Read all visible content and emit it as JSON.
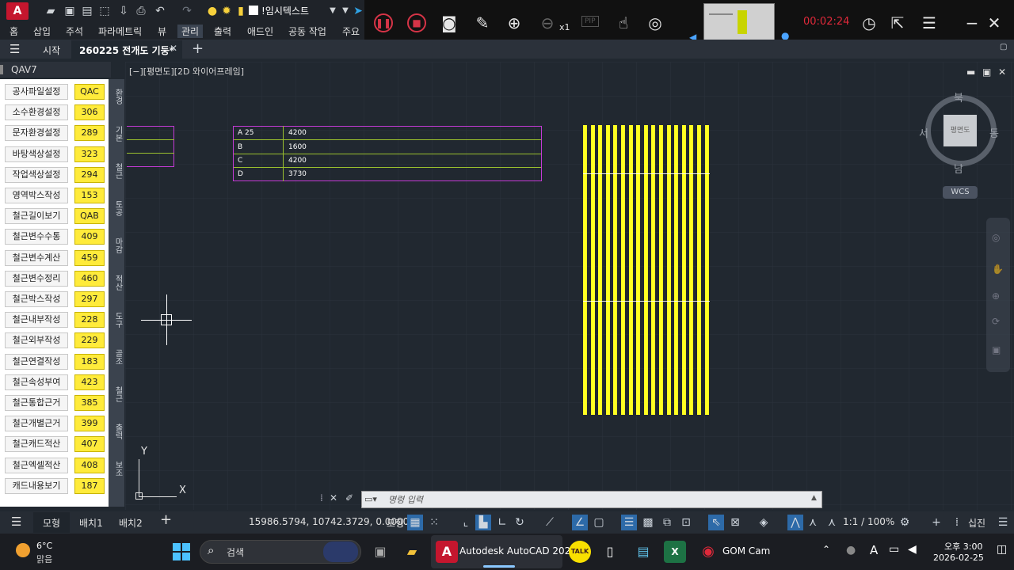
{
  "app": {
    "logo": "A",
    "layer_name": "!임시텍스트"
  },
  "ribbon_menu": [
    "홈",
    "삽입",
    "주석",
    "파라메트릭",
    "뷰",
    "관리",
    "출력",
    "애드인",
    "공동 작업",
    "주요"
  ],
  "gom": {
    "zoom_label": "x1",
    "time": "00:02:24",
    "pip": "PIP"
  },
  "tabs": {
    "start": "시작",
    "doc": "260225 전개도 기둥*"
  },
  "panel": {
    "title": "QAV7",
    "items": [
      {
        "label": "공사파일설정",
        "code": "QAC"
      },
      {
        "label": "소수환경설정",
        "code": "306"
      },
      {
        "label": "문자환경설정",
        "code": "289"
      },
      {
        "label": "바탕색상설정",
        "code": "323"
      },
      {
        "label": "작업색상설정",
        "code": "294"
      },
      {
        "label": "영역박스작성",
        "code": "153"
      },
      {
        "label": "철근길이보기",
        "code": "QAB"
      },
      {
        "label": "철근변수수통",
        "code": "409"
      },
      {
        "label": "철근변수계산",
        "code": "459"
      },
      {
        "label": "철근변수정리",
        "code": "460"
      },
      {
        "label": "철근박스작성",
        "code": "297"
      },
      {
        "label": "철근내부작성",
        "code": "228"
      },
      {
        "label": "철근외부작성",
        "code": "229"
      },
      {
        "label": "철근연결작성",
        "code": "183"
      },
      {
        "label": "철근속성부여",
        "code": "423"
      },
      {
        "label": "철근통합근거",
        "code": "385"
      },
      {
        "label": "철근개별근거",
        "code": "399"
      },
      {
        "label": "철근캐드적산",
        "code": "407"
      },
      {
        "label": "철근엑셀적산",
        "code": "408"
      },
      {
        "label": "캐드내용보기",
        "code": "187"
      }
    ],
    "vtabs": [
      "환경",
      "기본",
      "철근",
      "토공",
      "마감",
      "적산",
      "도구",
      "골조",
      "철근",
      "출력",
      "보조"
    ]
  },
  "viewport": {
    "label": "[−][평면도][2D 와이어프레임]",
    "table": [
      {
        "key": "A 25",
        "value": "4200"
      },
      {
        "key": "B",
        "value": "1600"
      },
      {
        "key": "C",
        "value": "4200"
      },
      {
        "key": "D",
        "value": "3730"
      }
    ],
    "ucs": {
      "x": "X",
      "y": "Y"
    }
  },
  "viewcube": {
    "top": "북",
    "left": "서",
    "right": "동",
    "bottom": "남",
    "face": "평면도",
    "wcs": "WCS"
  },
  "command": {
    "placeholder": "명령 입력"
  },
  "status": {
    "model_tab": "모형",
    "layout1": "배치1",
    "layout2": "배치2",
    "coords": "15986.5794, 10742.3729, 0.0000",
    "space": "모형",
    "scale": "1:1 / 100%",
    "mode": "십진"
  },
  "taskbar": {
    "weather_temp": "6°C",
    "weather_desc": "맑음",
    "search": "검색",
    "autocad": "Autodesk AutoCAD 202",
    "talk": "TALK",
    "gom": "GOM Cam",
    "time": "오후 3:00",
    "date": "2026-02-25",
    "ime": "A"
  }
}
